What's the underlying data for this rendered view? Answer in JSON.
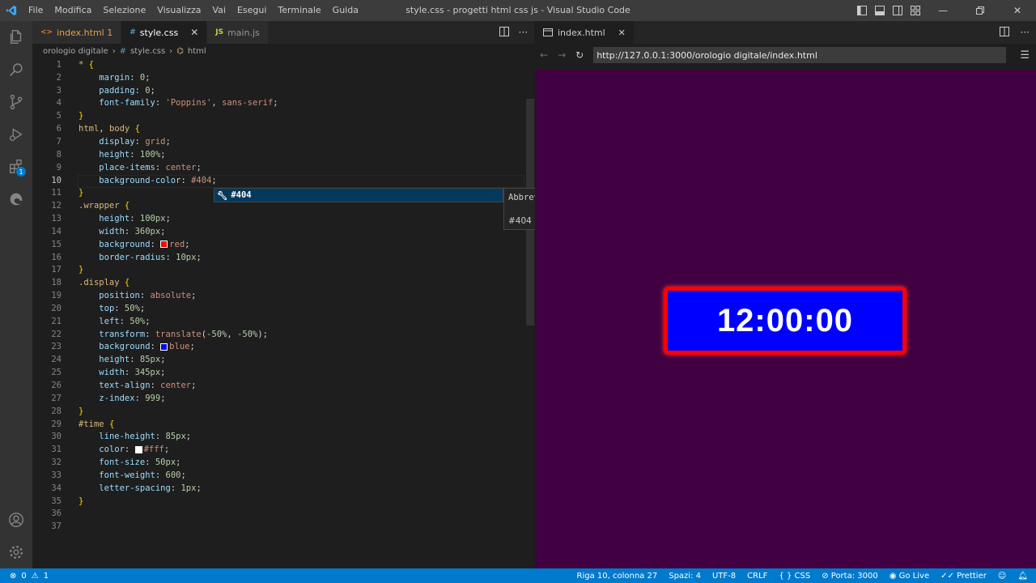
{
  "menu": [
    "File",
    "Modifica",
    "Selezione",
    "Visualizza",
    "Vai",
    "Esegui",
    "Terminale",
    "Guida"
  ],
  "window_title": "style.css - progetti html css js - Visual Studio Code",
  "activity": {
    "extensions_badge": "1"
  },
  "editor_tabs": [
    {
      "label": "index.html 1",
      "icon": "<>",
      "color": "#e37933"
    },
    {
      "label": "style.css",
      "icon": "#",
      "color": "#519aba"
    },
    {
      "label": "main.js",
      "icon": "JS",
      "color": "#cbcb41"
    }
  ],
  "breadcrumb": {
    "folder": "orologio digitale",
    "file": "style.css",
    "symbol": "html"
  },
  "code_lines": [
    {
      "n": "1",
      "html": "<span class=\"sel\">*</span> <span class=\"br\">{</span>"
    },
    {
      "n": "2",
      "html": "    <span class=\"prop\">margin</span>: <span class=\"num\">0</span>;"
    },
    {
      "n": "3",
      "html": "    <span class=\"prop\">padding</span>: <span class=\"num\">0</span>;"
    },
    {
      "n": "4",
      "html": "    <span class=\"prop\">font-family</span>: <span class=\"val\">'Poppins'</span>, <span class=\"val\">sans-serif</span>;"
    },
    {
      "n": "5",
      "html": "<span class=\"br\">}</span>"
    },
    {
      "n": "6",
      "html": "<span class=\"sel\">html</span>, <span class=\"sel\">body</span> <span class=\"br\">{</span>"
    },
    {
      "n": "7",
      "html": "    <span class=\"prop\">display</span>: <span class=\"val\">grid</span>;"
    },
    {
      "n": "8",
      "html": "    <span class=\"prop\">height</span>: <span class=\"num\">100%</span>;"
    },
    {
      "n": "9",
      "html": "    <span class=\"prop\">place-items</span>: <span class=\"val\">center</span>;"
    },
    {
      "n": "10",
      "html": "    <span class=\"prop\">background-color</span>: <span class=\"val\">#404</span>;"
    },
    {
      "n": "11",
      "html": "<span class=\"br\">}</span>"
    },
    {
      "n": "12",
      "html": "<span class=\"sel\">.wrapper</span> <span class=\"br\">{</span>"
    },
    {
      "n": "13",
      "html": "    <span class=\"prop\">height</span>: <span class=\"num\">100px</span>;"
    },
    {
      "n": "14",
      "html": "    <span class=\"prop\">width</span>: <span class=\"num\">360px</span>;"
    },
    {
      "n": "15",
      "html": "    <span class=\"prop\">background</span>: <span class=\"swatch\" style=\"background:red\"></span><span class=\"val\">red</span>;"
    },
    {
      "n": "16",
      "html": "    <span class=\"prop\">border-radius</span>: <span class=\"num\">10px</span>;"
    },
    {
      "n": "17",
      "html": "<span class=\"br\">}</span>"
    },
    {
      "n": "18",
      "html": "<span class=\"sel\">.display</span> <span class=\"br\">{</span>"
    },
    {
      "n": "19",
      "html": "    <span class=\"prop\">position</span>: <span class=\"val\">absolute</span>;"
    },
    {
      "n": "20",
      "html": "    <span class=\"prop\">top</span>: <span class=\"num\">50%</span>;"
    },
    {
      "n": "21",
      "html": "    <span class=\"prop\">left</span>: <span class=\"num\">50%</span>;"
    },
    {
      "n": "22",
      "html": "    <span class=\"prop\">transform</span>: <span class=\"val\">translate</span>(<span class=\"num\">-50%</span>, <span class=\"num\">-50%</span>);"
    },
    {
      "n": "23",
      "html": "    <span class=\"prop\">background</span>: <span class=\"swatch\" style=\"background:blue\"></span><span class=\"val\">blue</span>;"
    },
    {
      "n": "24",
      "html": "    <span class=\"prop\">height</span>: <span class=\"num\">85px</span>;"
    },
    {
      "n": "25",
      "html": "    <span class=\"prop\">width</span>: <span class=\"num\">345px</span>;"
    },
    {
      "n": "26",
      "html": "    <span class=\"prop\">text-align</span>: <span class=\"val\">center</span>;"
    },
    {
      "n": "27",
      "html": "    <span class=\"prop\">z-index</span>: <span class=\"num\">999</span>;"
    },
    {
      "n": "28",
      "html": "<span class=\"br\">}</span>"
    },
    {
      "n": "29",
      "html": "<span class=\"sel\">#time</span> <span class=\"br\">{</span>"
    },
    {
      "n": "30",
      "html": "    <span class=\"prop\">line-height</span>: <span class=\"num\">85px</span>;"
    },
    {
      "n": "31",
      "html": "    <span class=\"prop\">color</span>: <span class=\"swatch\" style=\"background:#fff\"></span><span class=\"val\">#fff</span>;"
    },
    {
      "n": "32",
      "html": "    <span class=\"prop\">font-size</span>: <span class=\"num\">50px</span>;"
    },
    {
      "n": "33",
      "html": "    <span class=\"prop\">font-weight</span>: <span class=\"num\">600</span>;"
    },
    {
      "n": "34",
      "html": "    <span class=\"prop\">letter-spacing</span>: <span class=\"num\">1px</span>;"
    },
    {
      "n": "35",
      "html": "<span class=\"br\">}</span>"
    },
    {
      "n": "36",
      "html": ""
    },
    {
      "n": "37",
      "html": ""
    }
  ],
  "current_line": "10",
  "suggestion": {
    "label": "#404",
    "detail_title": "Abbreviazione Emmet",
    "detail_value": "#404",
    "close": "×"
  },
  "preview": {
    "tab_label": "index.html",
    "url": "http://127.0.0.1:3000/orologio digitale/index.html",
    "clock": "12:00:00"
  },
  "status": {
    "errors": "0",
    "warnings": "1",
    "position": "Riga 10, colonna 27",
    "spaces": "Spazi: 4",
    "encoding": "UTF-8",
    "eol": "CRLF",
    "language": "CSS",
    "port": "Porta: 3000",
    "golive": "Go Live",
    "prettier": "Prettier"
  }
}
